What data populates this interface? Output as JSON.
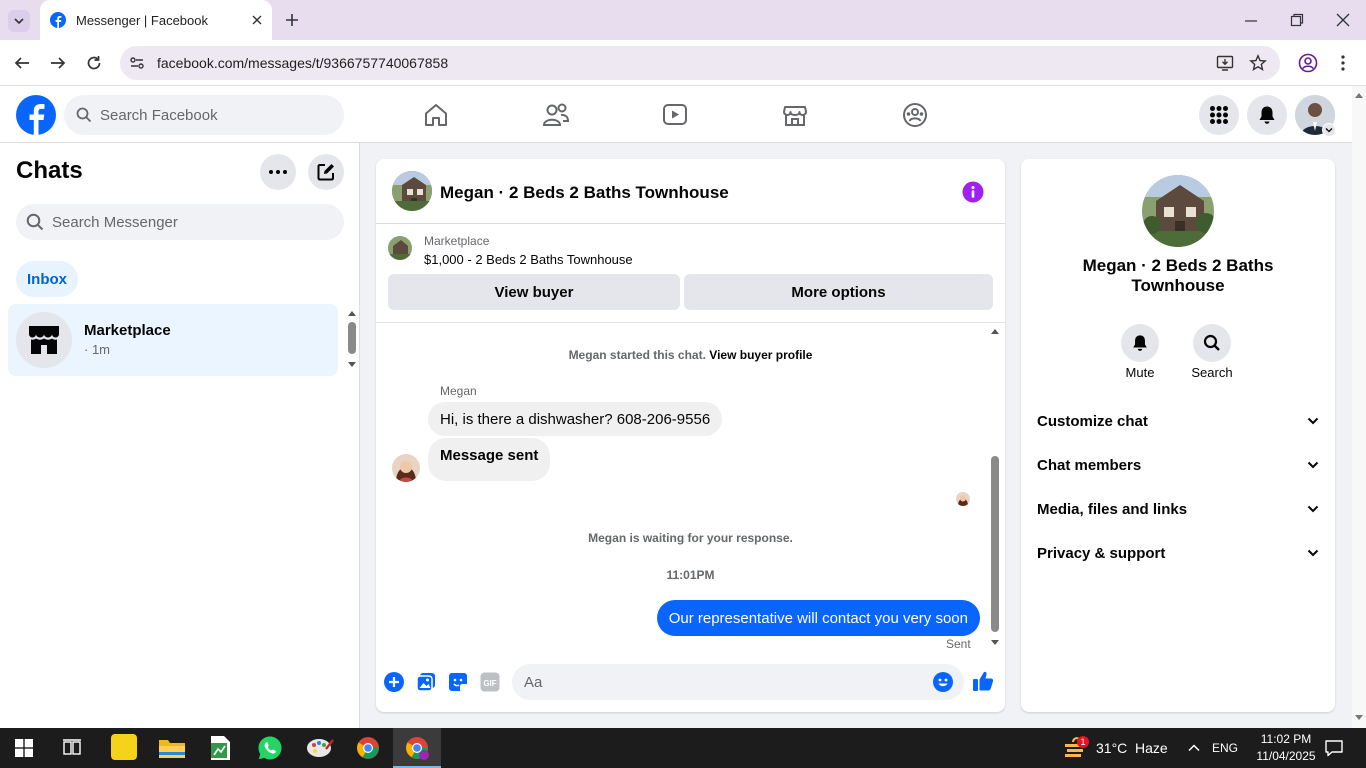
{
  "browser": {
    "tab_title": "Messenger | Facebook",
    "url": "facebook.com/messages/t/9366757740067858"
  },
  "header": {
    "search_placeholder": "Search Facebook"
  },
  "sidebar": {
    "title": "Chats",
    "search_placeholder": "Search Messenger",
    "filter_label": "Inbox",
    "chats": [
      {
        "name": "Marketplace",
        "meta": "· 1m"
      }
    ]
  },
  "conversation": {
    "title": "Megan · 2 Beds 2 Baths Townhouse",
    "listing": {
      "source": "Marketplace",
      "title": "$1,000 - 2 Beds 2 Baths Townhouse"
    },
    "actions": {
      "view_buyer": "View buyer",
      "more_options": "More options"
    },
    "started_text": "Megan started this chat.",
    "view_profile_link": "View buyer profile",
    "sender_name": "Megan",
    "messages": [
      {
        "text": "Hi, is there a dishwasher? 608-206-9556"
      },
      {
        "text": "Message sent"
      }
    ],
    "waiting_text": "Megan is waiting for your response.",
    "timestamp": "11:01PM",
    "outgoing": "Our representative will contact you very soon",
    "status": "Sent",
    "composer_placeholder": "Aa"
  },
  "info_panel": {
    "name": "Megan · 2 Beds 2 Baths Townhouse",
    "mute_label": "Mute",
    "search_label": "Search",
    "sections": [
      {
        "label": "Customize chat"
      },
      {
        "label": "Chat members"
      },
      {
        "label": "Media, files and links"
      },
      {
        "label": "Privacy & support"
      }
    ]
  },
  "taskbar": {
    "weather_temp": "31°C",
    "weather_desc": "Haze",
    "language": "ENG",
    "time": "11:02 PM",
    "date": "11/04/2025",
    "notification_count": "1"
  },
  "colors": {
    "brand_blue": "#0866ff",
    "info_purple": "#a020f0"
  }
}
